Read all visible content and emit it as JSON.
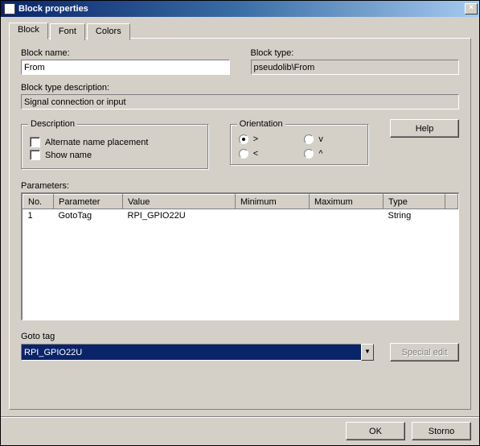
{
  "window": {
    "title": "Block properties"
  },
  "tabs": {
    "block": "Block",
    "font": "Font",
    "colors": "Colors"
  },
  "labels": {
    "block_name": "Block name:",
    "block_type": "Block type:",
    "block_type_desc": "Block type description:",
    "description_group": "Description",
    "alternate_name": "Alternate name placement",
    "show_name": "Show name",
    "orientation_group": "Orientation",
    "parameters": "Parameters:",
    "goto_tag": "Goto tag"
  },
  "fields": {
    "block_name": "From",
    "block_type": "pseudolib\\From",
    "block_type_desc": "Signal connection or input",
    "goto_tag": "RPI_GPIO22U"
  },
  "orientation": {
    "r": ">",
    "l": "<",
    "d": "v",
    "u": "^",
    "selected": "r"
  },
  "buttons": {
    "help": "Help",
    "special_edit": "Special edit",
    "ok": "OK",
    "cancel": "Storno"
  },
  "table": {
    "headers": {
      "no": "No.",
      "parameter": "Parameter",
      "value": "Value",
      "minimum": "Minimum",
      "maximum": "Maximum",
      "type": "Type"
    },
    "rows": [
      {
        "no": "1",
        "parameter": "GotoTag",
        "value": "RPI_GPIO22U",
        "minimum": "",
        "maximum": "",
        "type": "String"
      }
    ]
  }
}
